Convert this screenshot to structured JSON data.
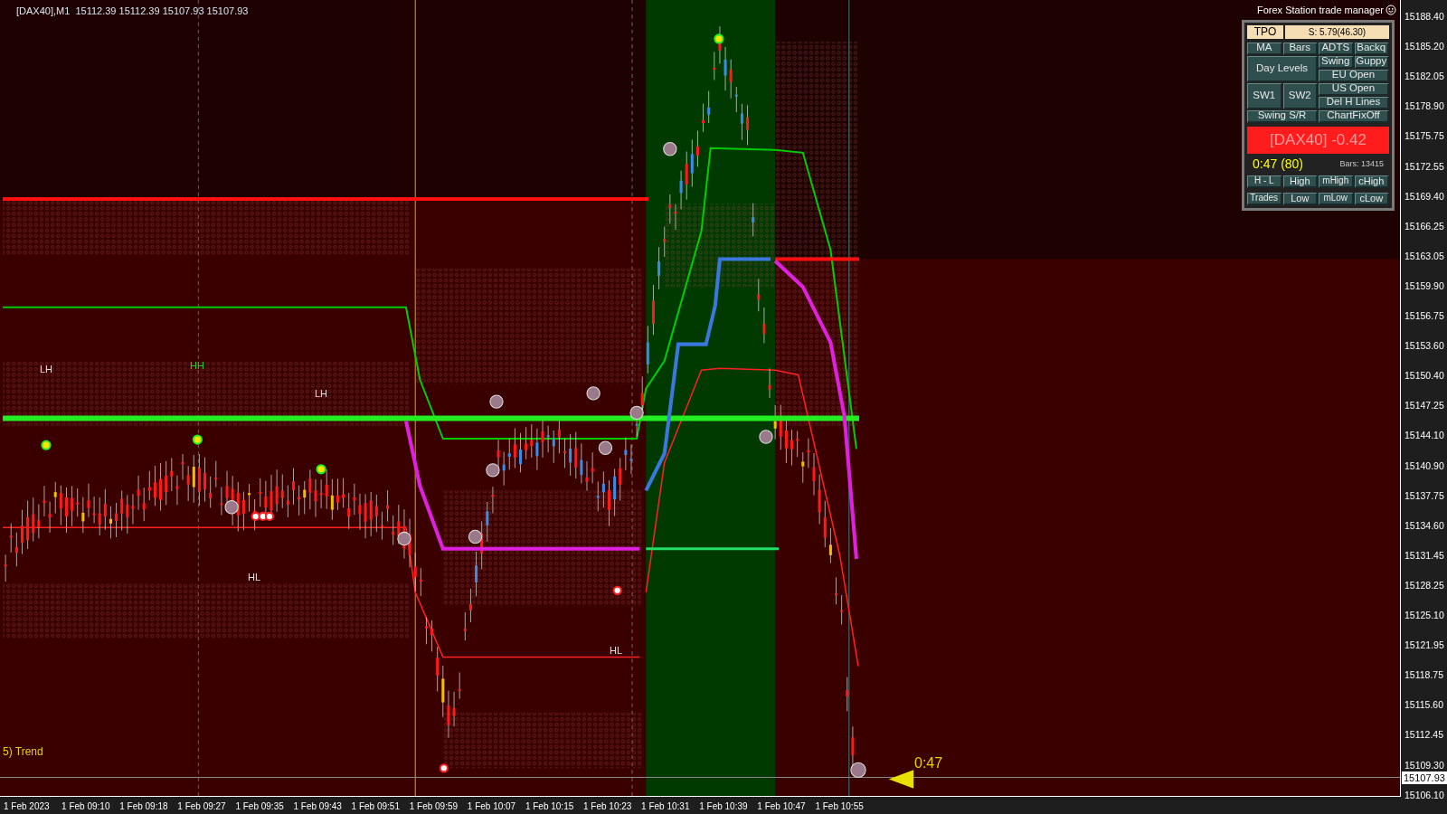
{
  "chart": {
    "info": "[DAX40],M1  15112.39 15112.39 15107.93 15107.93",
    "labels": [
      {
        "text": "LH",
        "color": "#e0e0e0"
      },
      {
        "text": "HH",
        "color": "#22cc22"
      },
      {
        "text": "LH",
        "color": "#e0e0e0"
      },
      {
        "text": "HL",
        "color": "#e0e0e0"
      },
      {
        "text": "HL",
        "color": "#e0e0e0"
      }
    ],
    "trend_label": "5) Trend",
    "countdown": "0:47"
  },
  "trade_manager": {
    "title": "Forex Station trade manager",
    "tpo": "TPO",
    "spread": "S: 5.79(46.30)",
    "buttons": [
      "MA",
      "Bars",
      "ADTS",
      "Backq",
      "Day Levels",
      "Swing",
      "Guppy",
      "EU Open",
      "SW1",
      "SW2",
      "US Open",
      "Del H Lines",
      "Swing S/R",
      "ChartFixOff"
    ],
    "status": "[DAX40] -0.42",
    "timer": "0:47 (80)",
    "bars": "Bars: 13415",
    "bottom_buttons": [
      "H - L",
      "High",
      "mHigh",
      "cHigh",
      "Trades",
      "Low",
      "mLow",
      "cLow"
    ]
  },
  "price_axis": {
    "ticks": [
      "15188.40",
      "15185.20",
      "15182.05",
      "15178.90",
      "15175.75",
      "15172.55",
      "15169.40",
      "15166.25",
      "15163.05",
      "15159.90",
      "15156.75",
      "15153.60",
      "15150.40",
      "15147.25",
      "15144.10",
      "15140.90",
      "15137.75",
      "15134.60",
      "15131.45",
      "15128.25",
      "15125.10",
      "15121.95",
      "15118.75",
      "15115.60",
      "15112.45",
      "15109.30",
      "15106.10"
    ],
    "current_price": "15107.93"
  },
  "time_axis": {
    "ticks": [
      "1 Feb 2023",
      "1 Feb 09:10",
      "1 Feb 09:18",
      "1 Feb 09:27",
      "1 Feb 09:35",
      "1 Feb 09:43",
      "1 Feb 09:51",
      "1 Feb 09:59",
      "1 Feb 10:07",
      "1 Feb 10:15",
      "1 Feb 10:23",
      "1 Feb 10:31",
      "1 Feb 10:39",
      "1 Feb 10:47",
      "1 Feb 10:55"
    ]
  }
}
